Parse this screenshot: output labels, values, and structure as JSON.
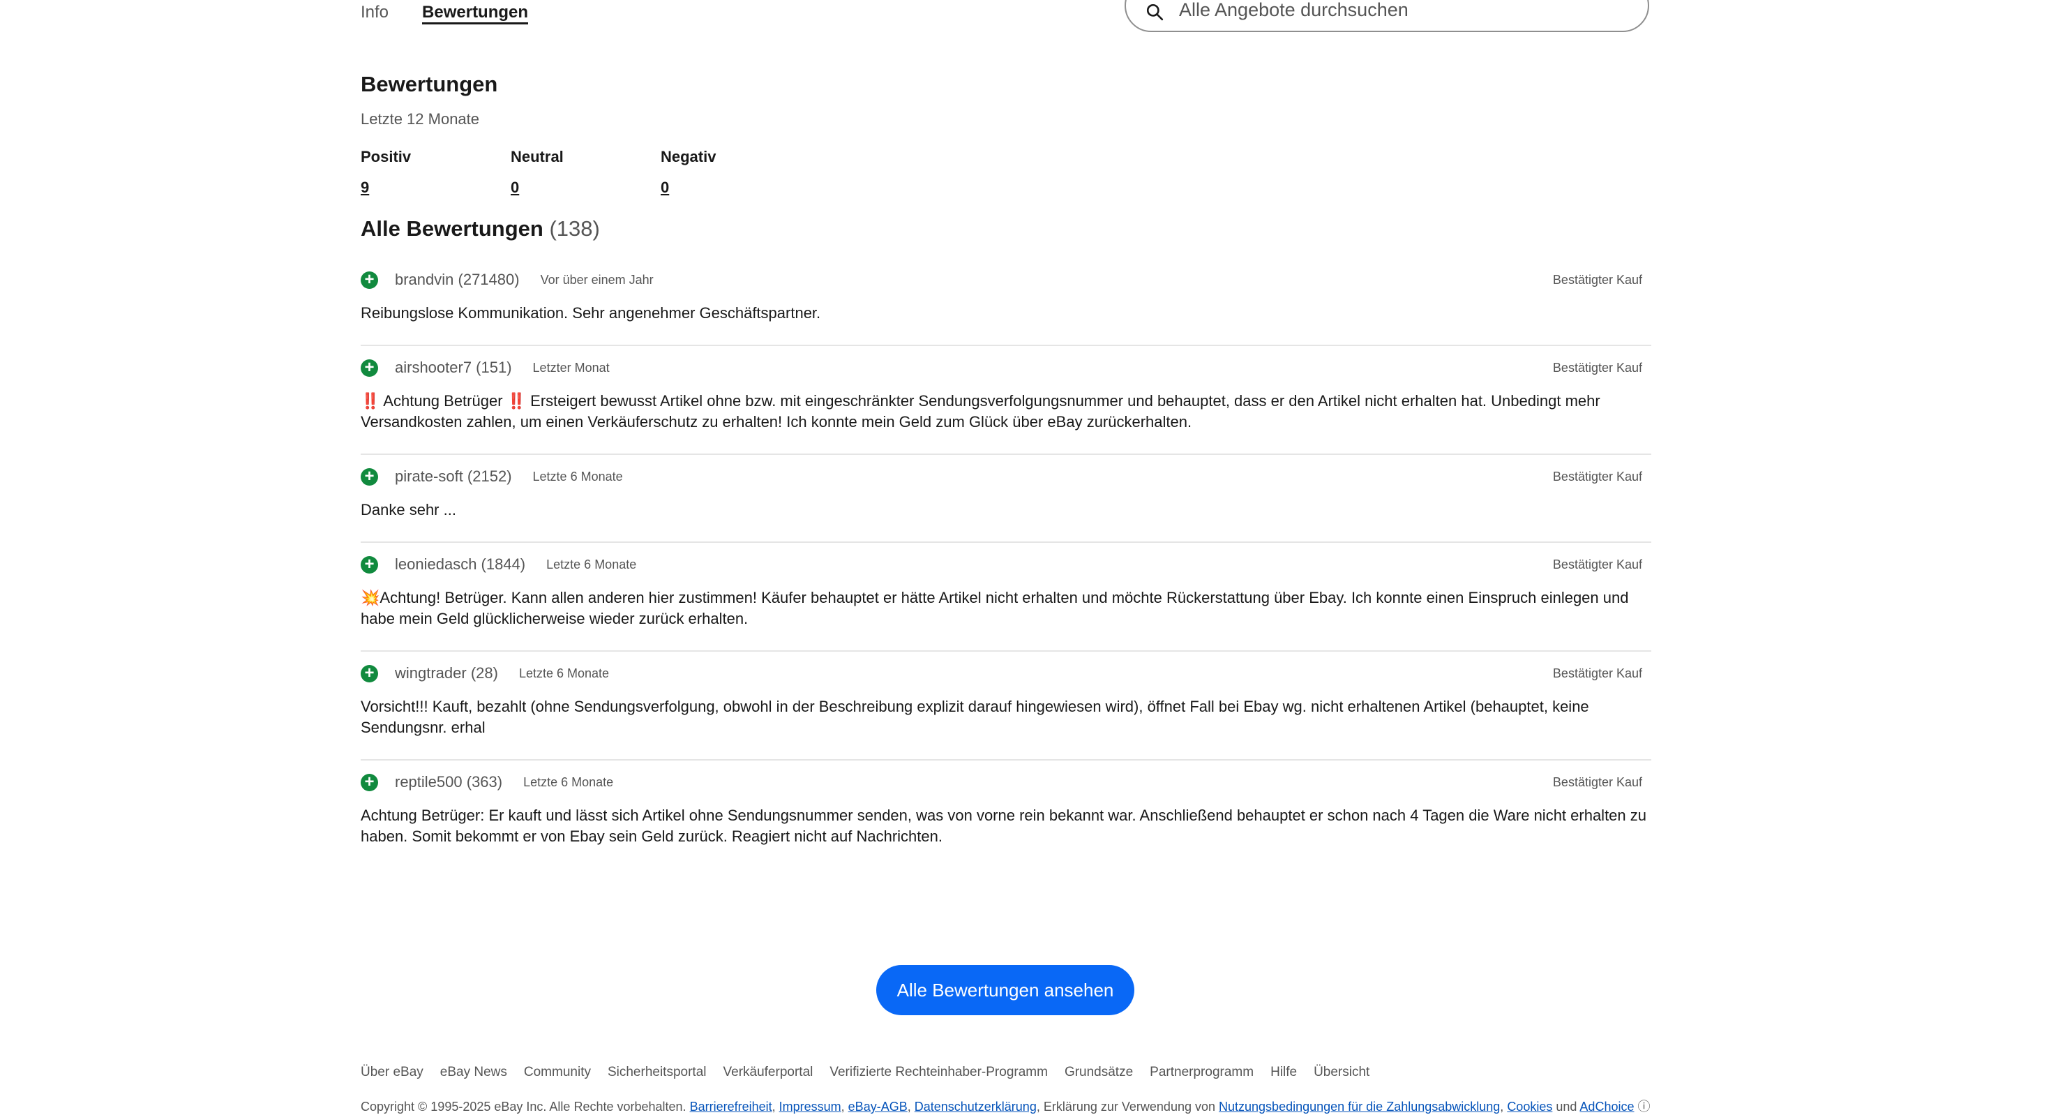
{
  "nav": {
    "tabs": [
      "Info",
      "Bewertungen"
    ],
    "active_tab": "Bewertungen"
  },
  "search": {
    "placeholder": "Alle Angebote durchsuchen"
  },
  "summary": {
    "title": "Bewertungen",
    "period": "Letzte 12 Monate",
    "stats": [
      {
        "label": "Positiv",
        "value": "9"
      },
      {
        "label": "Neutral",
        "value": "0"
      },
      {
        "label": "Negativ",
        "value": "0"
      }
    ]
  },
  "all_reviews": {
    "title": "Alle Bewertungen",
    "count": "(138)"
  },
  "reviews": [
    {
      "user": "brandvin (271480)",
      "when": "Vor über einem Jahr",
      "badge": "Bestätigter Kauf",
      "prefix": "",
      "text": "Reibungslose Kommunikation. Sehr angenehmer Geschäftspartner."
    },
    {
      "user": "airshooter7 (151)",
      "when": "Letzter Monat",
      "badge": "Bestätigter Kauf",
      "prefix": "‼️",
      "text": " Achtung Betrüger ‼️ Ersteigert bewusst Artikel ohne bzw. mit eingeschränkter Sendungsverfolgungsnummer und behauptet, dass er den Artikel nicht erhalten hat. Unbedingt mehr Versandkosten zahlen, um einen Verkäuferschutz zu erhalten! Ich konnte mein Geld zum Glück über eBay zurückerhalten."
    },
    {
      "user": "pirate-soft (2152)",
      "when": "Letzte 6 Monate",
      "badge": "Bestätigter Kauf",
      "prefix": "",
      "text": "Danke sehr ..."
    },
    {
      "user": "leoniedasch (1844)",
      "when": "Letzte 6 Monate",
      "badge": "Bestätigter Kauf",
      "prefix": "💥",
      "text": "Achtung! Betrüger. Kann allen anderen hier zustimmen! Käufer behauptet er hätte Artikel nicht erhalten und möchte Rückerstattung über Ebay. Ich konnte einen Einspruch einlegen und habe mein Geld glücklicherweise wieder zurück erhalten."
    },
    {
      "user": "wingtrader (28)",
      "when": "Letzte 6 Monate",
      "badge": "Bestätigter Kauf",
      "prefix": "",
      "text": "Vorsicht!!! Kauft, bezahlt (ohne Sendungsverfolgung, obwohl in der Beschreibung explizit darauf hingewiesen wird), öffnet Fall bei Ebay wg. nicht erhaltenen Artikel (behauptet, keine Sendungsnr. erhal"
    },
    {
      "user": "reptile500 (363)",
      "when": "Letzte 6 Monate",
      "badge": "Bestätigter Kauf",
      "prefix": "",
      "text": "Achtung Betrüger: Er kauft und lässt sich Artikel ohne Sendungsnummer senden, was von vorne rein bekannt war. Anschließend behauptet er schon nach 4 Tagen die Ware nicht erhalten zu haben. Somit bekommt er von Ebay sein Geld zurück. Reagiert nicht auf Nachrichten."
    }
  ],
  "button_all": "Alle Bewertungen ansehen",
  "footer": {
    "links": [
      "Über eBay",
      "eBay News",
      "Community",
      "Sicherheitsportal",
      "Verkäuferportal",
      "Verifizierte Rechteinhaber-Programm",
      "Grundsätze",
      "Partnerprogramm",
      "Hilfe",
      "Übersicht"
    ],
    "copyright": "Copyright © 1995-2025 eBay Inc. Alle Rechte vorbehalten.",
    "legal_links": [
      "Barrierefreiheit",
      "Impressum",
      "eBay-AGB",
      "Datenschutzerklärung"
    ],
    "middle_text": ", Erklärung zur Verwendung von",
    "payments_link": "Nutzungsbedingungen für die Zahlungsabwicklung",
    "cookies_link": "Cookies",
    "und": "und",
    "adchoice_link": "AdChoice"
  },
  "colors": {
    "accent": "#0968f6",
    "positive": "#118a3e",
    "link": "#0654ba"
  }
}
